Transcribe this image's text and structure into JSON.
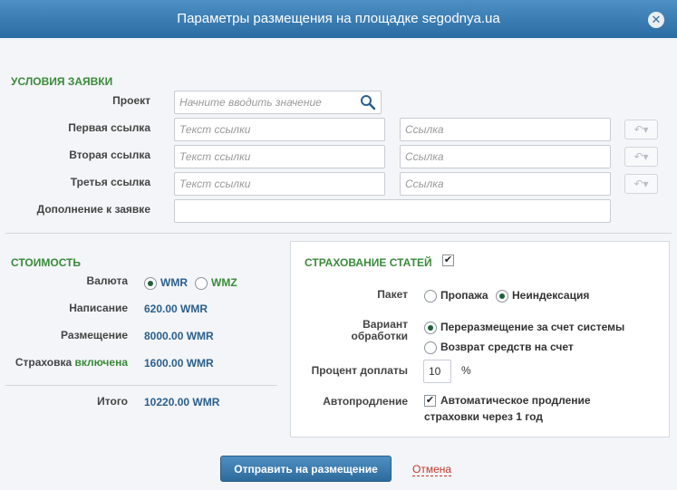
{
  "dialog": {
    "title": "Параметры размещения на площадке segodnya.ua",
    "close_label": "✕"
  },
  "conditions": {
    "section_title": "УСЛОВИЯ ЗАЯВКИ",
    "project_label": "Проект",
    "project_placeholder": "Начните вводить значение",
    "link1_label": "Первая ссылка",
    "link2_label": "Вторая ссылка",
    "link3_label": "Третья ссылка",
    "addition_label": "Дополнение к заявке",
    "link_text_placeholder": "Текст ссылки",
    "link_url_placeholder": "Ссылка"
  },
  "cost": {
    "section_title": "СТОИМОСТЬ",
    "currency_label": "Валюта",
    "currency_options": [
      "WMR",
      "WMZ"
    ],
    "currency_selected": "WMR",
    "writing_label": "Написание",
    "writing_value": "620.00 WMR",
    "placement_label": "Размещение",
    "placement_value": "8000.00 WMR",
    "insurance_label": "Страховка",
    "insurance_state": "включена",
    "insurance_value": "1600.00 WMR",
    "total_label": "Итого",
    "total_value": "10220.00 WMR"
  },
  "insurance": {
    "section_title": "СТРАХОВАНИЕ СТАТЕЙ",
    "enabled": true,
    "package_label": "Пакет",
    "package_options": [
      "Пропажа",
      "Неиндексация"
    ],
    "package_selected": "Неиндексация",
    "variant_label_line1": "Вариант",
    "variant_label_line2": "обработки",
    "variant_options": [
      "Переразмещение за счет системы",
      "Возврат средств на счет"
    ],
    "variant_selected": "Переразмещение за счет системы",
    "percent_label": "Процент доплаты",
    "percent_value": "10",
    "percent_unit": "%",
    "autorenew_label": "Автопродление",
    "autorenew_checked": true,
    "autorenew_text_line1": "Автоматическое продление",
    "autorenew_text_line2": "страховки через 1 год"
  },
  "actions": {
    "submit_label": "Отправить на размещение",
    "cancel_label": "Отмена"
  }
}
